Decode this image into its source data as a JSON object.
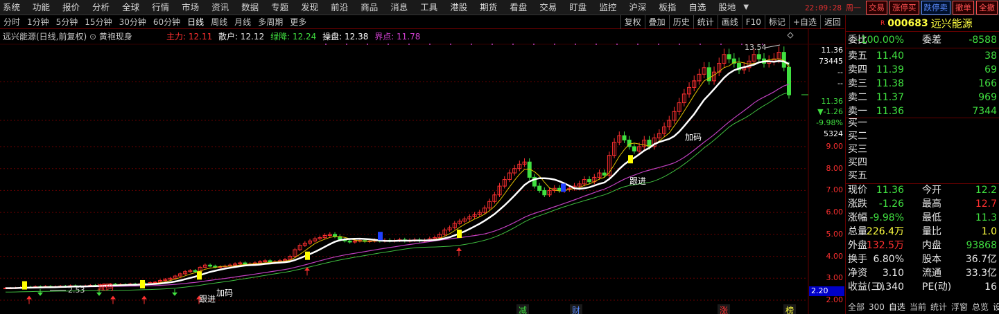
{
  "menu": {
    "items": [
      "系统",
      "功能",
      "报价",
      "分析",
      "全球",
      "行情",
      "市场",
      "资讯",
      "数据",
      "专题",
      "发现",
      "前沿",
      "商品",
      "消息",
      "工具",
      "港股",
      "期货",
      "看盘",
      "交易",
      "盯盘",
      "监控",
      "沪深",
      "板指",
      "自选",
      "股地"
    ],
    "clock": "22:09:28",
    "weekday": "周一",
    "buttons": [
      "交易",
      "涨停买",
      "跌停卖",
      "撤单",
      "全撤"
    ],
    "more_icon": "chevron-down-icon"
  },
  "periods": [
    "分时",
    "1分钟",
    "5分钟",
    "15分钟",
    "30分钟",
    "60分钟",
    "日线",
    "周线",
    "月线",
    "多周期",
    "更多"
  ],
  "active_period": "日线",
  "period_tools": [
    "复权",
    "叠加",
    "历史",
    "统计",
    "画线",
    "F10",
    "标记",
    "+自选",
    "返回"
  ],
  "chart": {
    "title": "远兴能源(日线,前复权)",
    "indicator_name": "黄袍现身",
    "indicators": {
      "main": "主力: 12.11",
      "retail": "散户: 12.12",
      "green": "绿降: 12.24",
      "ctrl": "操盘: 12.38",
      "bound": "界点: 11.78"
    },
    "high_label": "13.54",
    "low_label": "2.53",
    "annotations": [
      "加码",
      "跟进",
      "跟进",
      "加码",
      "减码",
      "跟进",
      "加码"
    ],
    "current_price_box": "2.20",
    "bottom_tags": [
      "减",
      "财",
      "涨",
      "榜"
    ]
  },
  "axis": {
    "ticks": [
      "9.00",
      "8.00",
      "7.00",
      "6.00",
      "5.00",
      "4.00",
      "3.00",
      "2.00"
    ],
    "top_price": "11.36",
    "top_vol": "73445",
    "dash1": "--",
    "dash2": "--",
    "price2": "11.36",
    "change": "▼-1.26",
    "pct": "-9.98%",
    "vol2": "5324"
  },
  "chart_data": {
    "type": "candlestick",
    "ylim": [
      1.8,
      14.5
    ],
    "ytick_labels": [
      "2.00",
      "3.00",
      "4.00",
      "5.00",
      "6.00",
      "7.00",
      "8.00",
      "9.00"
    ],
    "close_series": [
      2.55,
      2.55,
      2.56,
      2.58,
      2.6,
      2.58,
      2.62,
      2.6,
      2.63,
      2.6,
      2.62,
      2.64,
      2.62,
      2.66,
      2.64,
      2.63,
      2.65,
      2.68,
      2.66,
      2.7,
      2.7,
      2.73,
      2.68,
      2.72,
      2.7,
      2.74,
      2.72,
      2.75,
      2.74,
      2.8,
      2.82,
      2.9,
      2.95,
      3.0,
      3.1,
      3.2,
      3.3,
      3.35,
      3.3,
      3.5,
      3.6,
      3.55,
      3.5,
      3.52,
      3.55,
      3.6,
      3.65,
      3.7,
      3.62,
      3.65,
      3.7,
      3.75,
      3.8,
      3.7,
      3.75,
      3.8,
      3.85,
      4.0,
      4.3,
      4.5,
      4.6,
      4.7,
      4.8,
      4.85,
      4.95,
      5.0,
      4.9,
      4.75,
      4.7,
      4.65,
      4.7,
      4.72,
      4.68,
      4.7,
      4.72,
      4.7,
      4.73,
      4.7,
      4.72,
      4.75,
      4.7,
      4.72,
      4.75,
      4.7,
      4.72,
      4.8,
      4.85,
      5.0,
      5.2,
      5.3,
      5.5,
      5.6,
      5.7,
      5.8,
      5.9,
      6.0,
      6.2,
      6.5,
      6.8,
      7.2,
      7.5,
      7.8,
      8.0,
      8.2,
      8.3,
      7.6,
      7.2,
      7.0,
      6.8,
      7.0,
      7.1,
      7.0,
      7.05,
      7.1,
      7.2,
      7.3,
      7.5,
      7.4,
      7.6,
      7.8,
      7.7,
      8.6,
      9.2,
      9.5,
      9.3,
      9.0,
      8.8,
      9.0,
      9.3,
      9.0,
      9.4,
      9.6,
      9.9,
      10.2,
      10.6,
      11.0,
      11.4,
      11.7,
      12.0,
      12.3,
      12.6,
      12.0,
      12.4,
      12.8,
      13.2,
      13.0,
      12.8,
      12.5,
      12.6,
      12.9,
      13.2,
      13.0,
      12.8,
      12.9,
      13.0,
      13.3,
      12.62,
      11.36
    ],
    "annotations": {
      "high": 13.54,
      "low": 2.53
    }
  },
  "panel": {
    "code": "000683",
    "name": "远兴能源",
    "badge": "R",
    "weibi_label": "委比",
    "weibi_value": "-100.00%",
    "weicha_label": "委差",
    "weicha_value": "-8588",
    "asks": [
      {
        "label": "卖五",
        "price": "11.40",
        "vol": "38"
      },
      {
        "label": "卖四",
        "price": "11.39",
        "vol": "69"
      },
      {
        "label": "卖三",
        "price": "11.38",
        "vol": "166"
      },
      {
        "label": "卖二",
        "price": "11.37",
        "vol": "969"
      },
      {
        "label": "卖一",
        "price": "11.36",
        "vol": "7344"
      }
    ],
    "bids": [
      {
        "label": "买一",
        "price": "",
        "vol": ""
      },
      {
        "label": "买二",
        "price": "",
        "vol": ""
      },
      {
        "label": "买三",
        "price": "",
        "vol": ""
      },
      {
        "label": "买四",
        "price": "",
        "vol": ""
      },
      {
        "label": "买五",
        "price": "",
        "vol": ""
      }
    ],
    "stats": [
      {
        "l1": "现价",
        "v1": "11.36",
        "c1": "green",
        "l2": "今开",
        "v2": "12.2",
        "c2": "green"
      },
      {
        "l1": "涨跌",
        "v1": "-1.26",
        "c1": "green",
        "l2": "最高",
        "v2": "12.7",
        "c2": "red"
      },
      {
        "l1": "涨幅",
        "v1": "-9.98%",
        "c1": "green",
        "l2": "最低",
        "v2": "11.3",
        "c2": "green"
      },
      {
        "l1": "总量",
        "v1": "226.4万",
        "c1": "yellow",
        "l2": "量比",
        "v2": "1.0",
        "c2": "yellow"
      },
      {
        "l1": "外盘",
        "v1": "132.5万",
        "c1": "red",
        "l2": "内盘",
        "v2": "93868",
        "c2": "green"
      },
      {
        "l1": "换手",
        "v1": "6.80%",
        "c1": "white",
        "l2": "股本",
        "v2": "36.7亿",
        "c2": "white"
      },
      {
        "l1": "净资",
        "v1": "3.10",
        "c1": "white",
        "l2": "流通",
        "v2": "33.3亿",
        "c2": "white"
      },
      {
        "l1": "收益(三)",
        "v1": "0.340",
        "c1": "white",
        "l2": "PE(动)",
        "v2": "16",
        "c2": "white"
      }
    ],
    "footer": [
      "全部",
      "300",
      "自选",
      "当前",
      "统计",
      "浮窗",
      "总览",
      "设"
    ]
  },
  "colors": {
    "up": "#ff3030",
    "down": "#40e040",
    "ma_white": "#ffffff",
    "ma_yellow": "#e0c000",
    "ma_magenta": "#c040c0",
    "grid": "#660000"
  }
}
